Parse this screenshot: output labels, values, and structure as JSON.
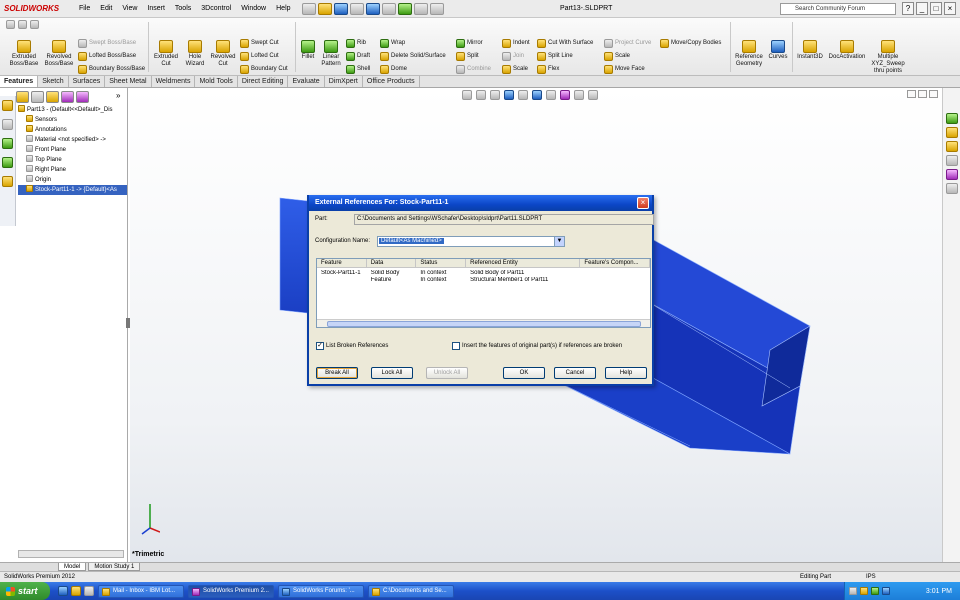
{
  "titlebar": {
    "app_logo": "SOLIDWORKS",
    "menus": [
      "File",
      "Edit",
      "View",
      "Insert",
      "Tools",
      "3Dcontrol",
      "Window",
      "Help"
    ],
    "doc_title": "Part13-.SLDPRT",
    "search_placeholder": "Search Community Forum",
    "help_glyph": "?"
  },
  "commands": {
    "extruded_boss": "Extruded\nBoss/Base",
    "revolved_boss": "Revolved\nBoss/Base",
    "swept_boss": "Swept Boss/Base",
    "lofted_boss": "Lofted Boss/Base",
    "boundary_boss": "Boundary Boss/Base",
    "extruded_cut": "Extruded\nCut",
    "hole_wizard": "Hole\nWizard",
    "revolved_cut": "Revolved\nCut",
    "swept_cut": "Swept Cut",
    "lofted_cut": "Lofted Cut",
    "boundary_cut": "Boundary Cut",
    "fillet": "Fillet",
    "linear_pattern": "Linear\nPattern",
    "rib": "Rib",
    "draft": "Draft",
    "shell": "Shell",
    "wrap": "Wrap",
    "delete_solid": "Delete Solid/Surface",
    "dome": "Dome",
    "mirror": "Mirror",
    "split": "Split",
    "combine": "Combine",
    "indent": "Indent",
    "join": "Join",
    "scale_a": "Scale",
    "cut_with_surface": "Cut With Surface",
    "split_line": "Split Line",
    "flex": "Flex",
    "project_curve": "Project Curve",
    "scale_b": "Scale",
    "move_face": "Move Face",
    "move_copy_bodies": "Move/Copy Bodies",
    "reference_geometry": "Reference\nGeometry",
    "curves": "Curves",
    "instant3d": "Instant3D",
    "docactivation": "DocActivation",
    "multiple_xyz": "Multiple\nXYZ_Sweep\nthru points"
  },
  "tabs": [
    "Features",
    "Sketch",
    "Surfaces",
    "Sheet Metal",
    "Weldments",
    "Mold Tools",
    "Direct Editing",
    "Evaluate",
    "DimXpert",
    "Office Products"
  ],
  "tree": {
    "root": "Part13 - (Default<<Default>_Dis",
    "items": [
      "Sensors",
      "Annotations",
      "Material <not specified> ->",
      "Front Plane",
      "Top Plane",
      "Right Plane",
      "Origin",
      "Stock-Part11-1 -> {Default}<As"
    ]
  },
  "model_tabs": [
    "Model",
    "Motion Study 1"
  ],
  "status": {
    "left": "SolidWorks Premium 2012",
    "editing": "Editing Part",
    "units": "IPS"
  },
  "viewport": {
    "orientation": "*Trimetric",
    "part_color": "#1a3fd0"
  },
  "dialog": {
    "title": "External References For: Stock-Part11-1",
    "part_label": "Part:",
    "part_path": "C:\\Documents and Settings\\WSchafer\\Desktop\\sldprt\\Part11.SLDPRT",
    "config_label": "Configuration Name:",
    "config_value": "Default<As Machined>",
    "columns": [
      "Feature",
      "Data",
      "Status",
      "Referenced Entity",
      "Feature's Compon..."
    ],
    "rows": [
      [
        "Stock-Part11-1",
        "Solid Body",
        "In context",
        "Solid Body of Part11",
        ""
      ],
      [
        "",
        "Feature",
        "In context",
        "Structural Member1 of Part11",
        ""
      ]
    ],
    "list_broken": "List Broken References",
    "list_broken_checked": true,
    "insert_features": "Insert the features of original part(s) if references are broken",
    "insert_features_checked": false,
    "buttons": {
      "break_all": "Break All",
      "lock_all": "Lock All",
      "unlock_all": "Unlock All",
      "ok": "OK",
      "cancel": "Cancel",
      "help": "Help"
    }
  },
  "taskbar": {
    "start": "start",
    "tasks": [
      "Mail - Inbox - IBM Lot...",
      "SolidWorks Premium 2...",
      "SolidWorks Forums: '...",
      "C:\\Documents and Se..."
    ],
    "clock": "3:01 PM"
  }
}
